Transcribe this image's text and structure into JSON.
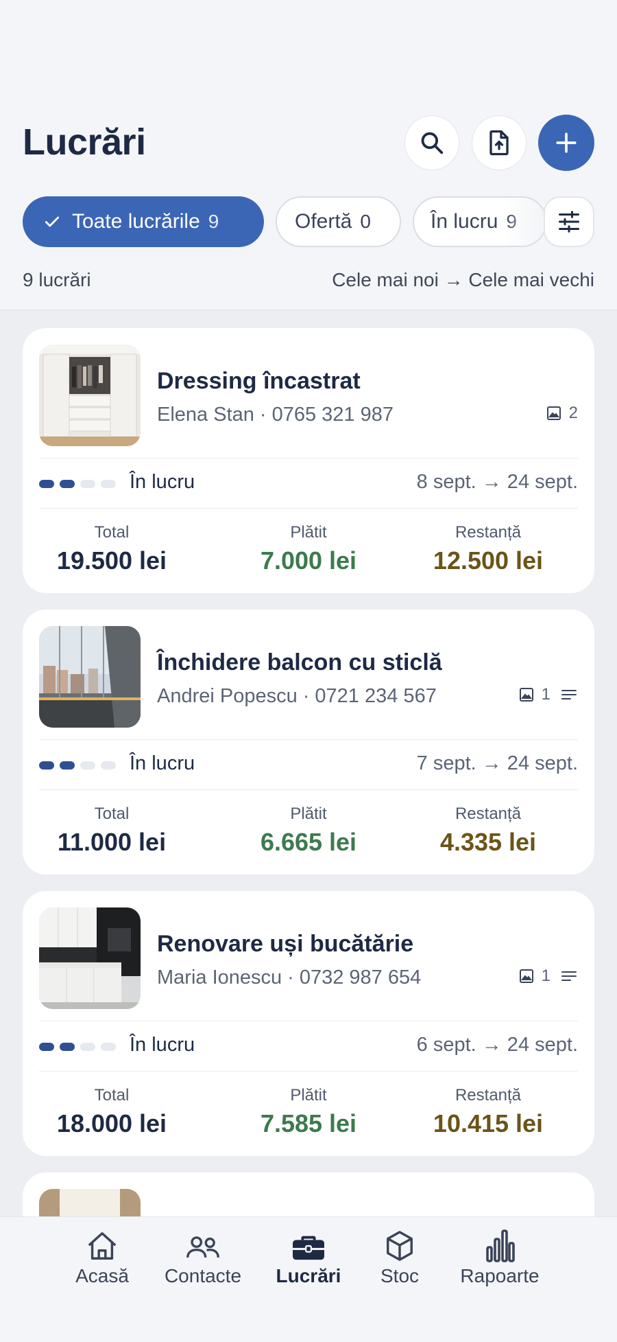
{
  "header": {
    "title": "Lucrări",
    "actions": [
      {
        "name": "search-button",
        "icon": "search-icon"
      },
      {
        "name": "export-button",
        "icon": "file-upload-icon"
      },
      {
        "name": "add-button",
        "icon": "plus-icon"
      }
    ]
  },
  "filters": {
    "chips": [
      {
        "label": "Toate lucrările",
        "count": "9",
        "active": true
      },
      {
        "label": "Ofertă",
        "count": "0",
        "active": false
      },
      {
        "label": "În lucru",
        "count": "9",
        "active": false
      }
    ],
    "settings_icon": "sliders-icon"
  },
  "summary": {
    "count": "9 lucrări",
    "sort": "Cele mai noi → Cele mai vechi"
  },
  "labels": {
    "total": "Total",
    "paid": "Plătit",
    "due": "Restanță"
  },
  "jobs": [
    {
      "title": "Dressing încastrat",
      "client": "Elena Stan",
      "phone": "0765 321 987",
      "photos": "2",
      "has_notes": false,
      "progress": 2,
      "progress_steps": 4,
      "status": "În lucru",
      "dates": "8 sept. → 24 sept.",
      "total": "19.500 lei",
      "paid": "7.000 lei",
      "due": "12.500 lei"
    },
    {
      "title": "Închidere balcon cu sticlă",
      "client": "Andrei Popescu",
      "phone": "0721 234 567",
      "photos": "1",
      "has_notes": true,
      "progress": 2,
      "progress_steps": 4,
      "status": "În lucru",
      "dates": "7 sept. → 24 sept.",
      "total": "11.000 lei",
      "paid": "6.665 lei",
      "due": "4.335 lei"
    },
    {
      "title": "Renovare uși bucătărie",
      "client": "Maria Ionescu",
      "phone": "0732 987 654",
      "photos": "1",
      "has_notes": true,
      "progress": 2,
      "progress_steps": 4,
      "status": "În lucru",
      "dates": "6 sept. → 24 sept.",
      "total": "18.000 lei",
      "paid": "7.585 lei",
      "due": "10.415 lei"
    }
  ],
  "tabbar": [
    {
      "label": "Acasă",
      "icon": "home-icon",
      "active": false
    },
    {
      "label": "Contacte",
      "icon": "people-icon",
      "active": false
    },
    {
      "label": "Lucrări",
      "icon": "briefcase-icon",
      "active": true
    },
    {
      "label": "Stoc",
      "icon": "box-icon",
      "active": false
    },
    {
      "label": "Rapoarte",
      "icon": "bar-chart-icon",
      "active": false
    }
  ],
  "colors": {
    "accent": "#3b66b5",
    "progress_on": "#2f4f94",
    "paid": "#3d7a4e",
    "due": "#6b5418",
    "text": "#1e2a44"
  }
}
